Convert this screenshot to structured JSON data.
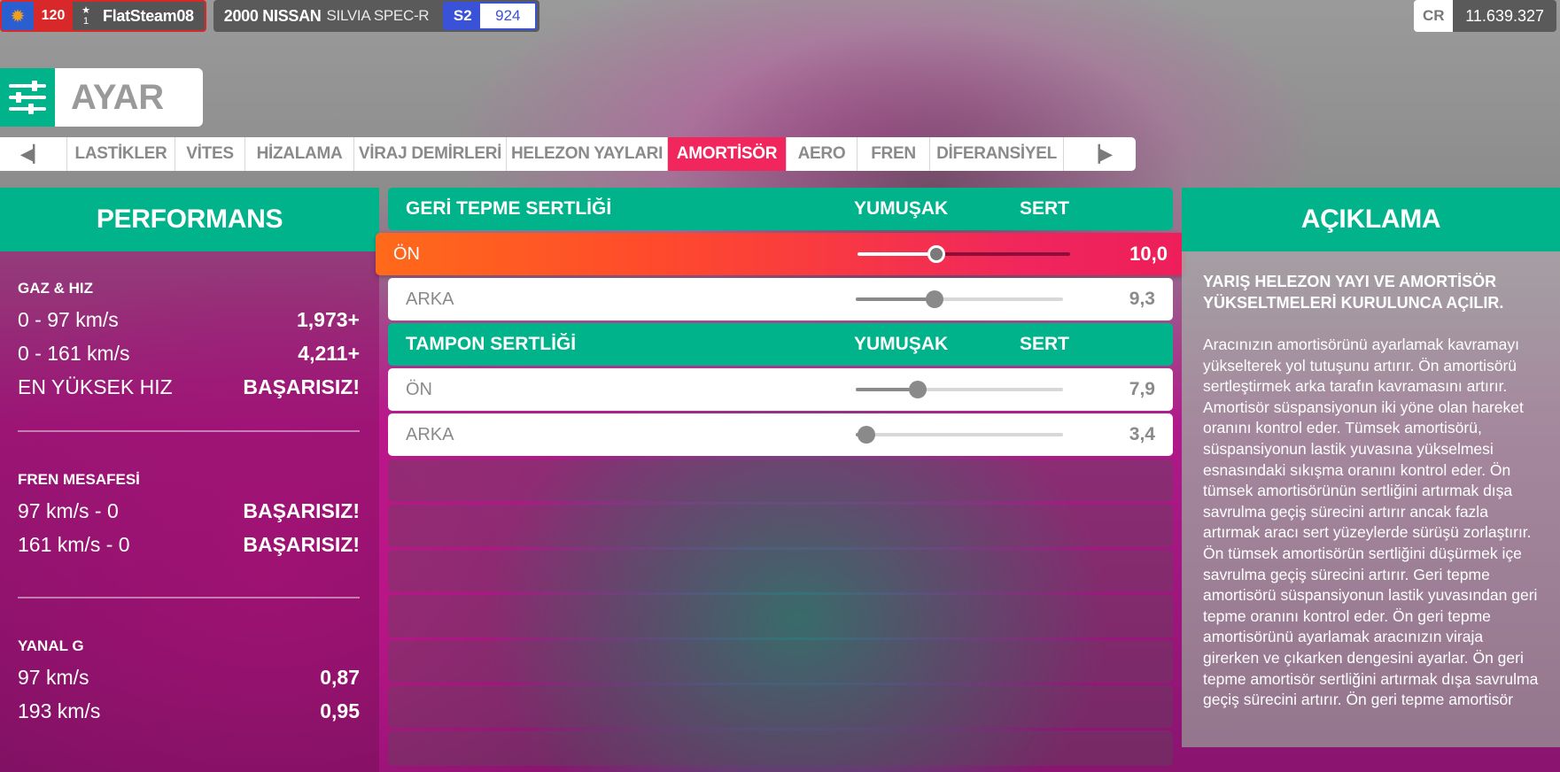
{
  "player": {
    "avatar_icon": "hedgehog-icon",
    "level": "120",
    "rank": "1",
    "gamertag": "FlatSteam08"
  },
  "car": {
    "year_make": "2000 NISSAN",
    "model": "SILVIA SPEC-R",
    "class": "S2",
    "pi": "924"
  },
  "credits": {
    "label": "CR",
    "value": "11.639.327"
  },
  "page": {
    "title": "AYAR",
    "icon": "tune-sliders-icon"
  },
  "tabs": [
    {
      "label": "LASTİKLER"
    },
    {
      "label": "VİTES"
    },
    {
      "label": "HİZALAMA"
    },
    {
      "label": "VİRAJ DEMİRLERİ"
    },
    {
      "label": "HELEZON YAYLARI"
    },
    {
      "label": "AMORTİSÖR",
      "active": true
    },
    {
      "label": "AERO"
    },
    {
      "label": "FREN"
    },
    {
      "label": "DİFERANSİYEL"
    }
  ],
  "performance": {
    "title": "PERFORMANS",
    "sections": [
      {
        "title": "GAZ & HIZ",
        "rows": [
          {
            "label": "0 - 97 km/s",
            "value": "1,973+"
          },
          {
            "label": "0 - 161 km/s",
            "value": "4,211+"
          },
          {
            "label": "EN YÜKSEK HIZ",
            "value": "BAŞARISIZ!"
          }
        ]
      },
      {
        "title": "FREN MESAFESİ",
        "rows": [
          {
            "label": "97 km/s - 0",
            "value": "BAŞARISIZ!"
          },
          {
            "label": "161 km/s - 0",
            "value": "BAŞARISIZ!"
          }
        ]
      },
      {
        "title": "YANAL G",
        "rows": [
          {
            "label": "97 km/s",
            "value": "0,87"
          },
          {
            "label": "193 km/s",
            "value": "0,95"
          }
        ]
      }
    ]
  },
  "tuning": {
    "soft_label": "YUMUŞAK",
    "hard_label": "SERT",
    "groups": [
      {
        "title": "GERİ TEPME SERTLİĞİ",
        "rows": [
          {
            "label": "ÖN",
            "value": "10,0",
            "fraction": 0.37,
            "selected": true
          },
          {
            "label": "ARKA",
            "value": "9,3",
            "fraction": 0.38
          }
        ]
      },
      {
        "title": "TAMPON SERTLİĞİ",
        "rows": [
          {
            "label": "ÖN",
            "value": "7,9",
            "fraction": 0.3
          },
          {
            "label": "ARKA",
            "value": "3,4",
            "fraction": 0.05
          }
        ]
      }
    ]
  },
  "description": {
    "title": "AÇIKLAMA",
    "heading": "YARIŞ HELEZON YAYI VE AMORTİSÖR YÜKSELTMELERİ KURULUNCA AÇILIR.",
    "text": "Aracınızın amortisörünü ayarlamak kavramayı yükselterek yol tutuşunu artırır. Ön amortisörü sertleştirmek arka tarafın kavramasını artırır. Amortisör süspansiyonun iki yöne olan hareket oranını kontrol eder. Tümsek amortisörü, süspansiyonun lastik yuvasına yükselmesi esnasındaki sıkışma oranını kontrol eder. Ön tümsek amortisörünün sertliğini artırmak dışa savrulma geçiş sürecini artırır ancak fazla artırmak aracı sert yüzeylerde sürüşü zorlaştırır. Ön tümsek amortisörün sertliğini düşürmek içe savrulma geçiş sürecini artırır. Geri tepme amortisörü süspansiyonun lastik yuvasından geri tepme oranını kontrol eder. Ön geri tepme amortisörünü ayarlamak aracınızın viraja girerken ve çıkarken dengesini ayarlar. Ön geri tepme amortisör sertliğini artırmak dışa savrulma geçiş sürecini artırır. Ön geri tepme amortisör"
  }
}
